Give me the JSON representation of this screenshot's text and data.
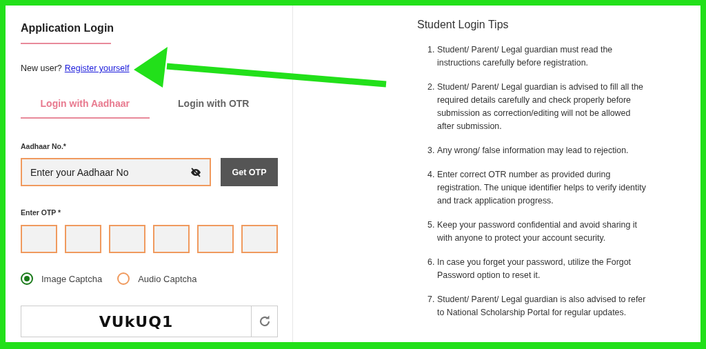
{
  "login": {
    "title": "Application Login",
    "new_user_text": "New user?",
    "register_link": "Register yourself",
    "tabs": [
      {
        "label": "Login with Aadhaar",
        "selected": true
      },
      {
        "label": "Login with OTR",
        "selected": false
      }
    ],
    "aadhaar_field": {
      "label": "Aadhaar No.*",
      "placeholder": "Enter your Aadhaar No"
    },
    "get_otp_button": "Get OTP",
    "otp_label": "Enter OTP *",
    "captcha_options": [
      {
        "label": "Image Captcha",
        "selected": true
      },
      {
        "label": "Audio Captcha",
        "selected": false
      }
    ],
    "captcha_text": "VUkUQ1"
  },
  "tips": {
    "title": "Student Login Tips",
    "items": [
      {
        "number": "1.",
        "text": "Student/ Parent/ Legal guardian must read the instructions carefully before registration."
      },
      {
        "number": "2.",
        "text": "Student/ Parent/ Legal guardian is advised to fill all the required details carefully and check properly before submission as correction/editing will not be allowed after submission."
      },
      {
        "number": "3.",
        "text": "Any wrong/ false information may lead to rejection."
      },
      {
        "number": "4.",
        "text": "Enter correct OTR number as provided during registration. The unique identifier helps to verify identity and track application progress."
      },
      {
        "number": "5.",
        "text": "Keep your password confidential and avoid sharing it with anyone to protect your account security."
      },
      {
        "number": "6.",
        "text": "In case you forget your password, utilize the Forgot Password option to reset it."
      },
      {
        "number": "7.",
        "text": "Student/ Parent/ Legal guardian is also advised to refer to National Scholarship Portal for regular updates."
      }
    ]
  }
}
